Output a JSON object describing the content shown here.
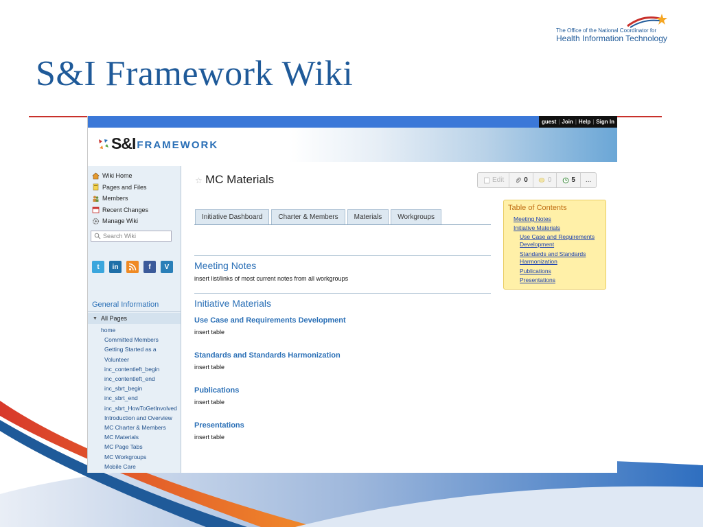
{
  "slide": {
    "title": "S&I Framework Wiki",
    "onc_logo": {
      "line1": "The Office of the National Coordinator for",
      "line2": "Health Information Technology"
    }
  },
  "userbar": {
    "guest": "guest",
    "join": "Join",
    "help": "Help",
    "signin": "Sign In"
  },
  "brand": {
    "name": "S&I",
    "suffix": "FRAMEWORK"
  },
  "sidebar": {
    "nav": [
      {
        "label": "Wiki Home",
        "icon": "home-icon"
      },
      {
        "label": "Pages and Files",
        "icon": "pages-icon"
      },
      {
        "label": "Members",
        "icon": "members-icon"
      },
      {
        "label": "Recent Changes",
        "icon": "calendar-icon"
      },
      {
        "label": "Manage Wiki",
        "icon": "gear-icon"
      }
    ],
    "search_placeholder": "Search Wiki",
    "social": [
      "twitter-icon",
      "linkedin-icon",
      "rss-icon",
      "facebook-icon",
      "vimeo-icon"
    ],
    "general_information": "General Information",
    "all_pages": "All Pages",
    "pages": [
      "home",
      "Committed Members",
      "Getting Started as a",
      "Volunteer",
      "inc_contentleft_begin",
      "inc_contentleft_end",
      "inc_sbrt_begin",
      "inc_sbrt_end",
      "inc_sbrt_HowToGetInvolved",
      "Introduction and Overview",
      "MC Charter & Members",
      "MC Materials",
      "MC Page Tabs",
      "MC Workgroups",
      "Mobile Care"
    ]
  },
  "page": {
    "title": "MC Materials",
    "actions": {
      "edit": "Edit",
      "attachments": "0",
      "comments": "0",
      "revisions": "5",
      "more": "..."
    },
    "tabs": [
      "Initiative Dashboard",
      "Charter & Members",
      "Materials",
      "Workgroups"
    ],
    "sections": {
      "meeting_notes": {
        "heading": "Meeting Notes",
        "body": "insert list/links of most current notes from all workgroups"
      },
      "initiative_materials": {
        "heading": "Initiative Materials"
      },
      "use_case": {
        "heading": "Use Case and Requirements Development",
        "body": "insert table"
      },
      "standards": {
        "heading": "Standards and Standards Harmonization",
        "body": "insert table"
      },
      "publications": {
        "heading": "Publications",
        "body": "insert table"
      },
      "presentations": {
        "heading": "Presentations",
        "body": "insert table"
      }
    }
  },
  "toc": {
    "title": "Table of Contents",
    "links": [
      "Meeting Notes",
      "Initiative Materials",
      "Use Case and Requirements Development",
      "Standards and Standards Harmonization",
      "Publications",
      "Presentations"
    ]
  },
  "colors": {
    "title_blue": "#1f5a99",
    "link_blue": "#2a6fb6",
    "rule_red": "#c8302b",
    "toc_bg": "#fff0a8"
  }
}
